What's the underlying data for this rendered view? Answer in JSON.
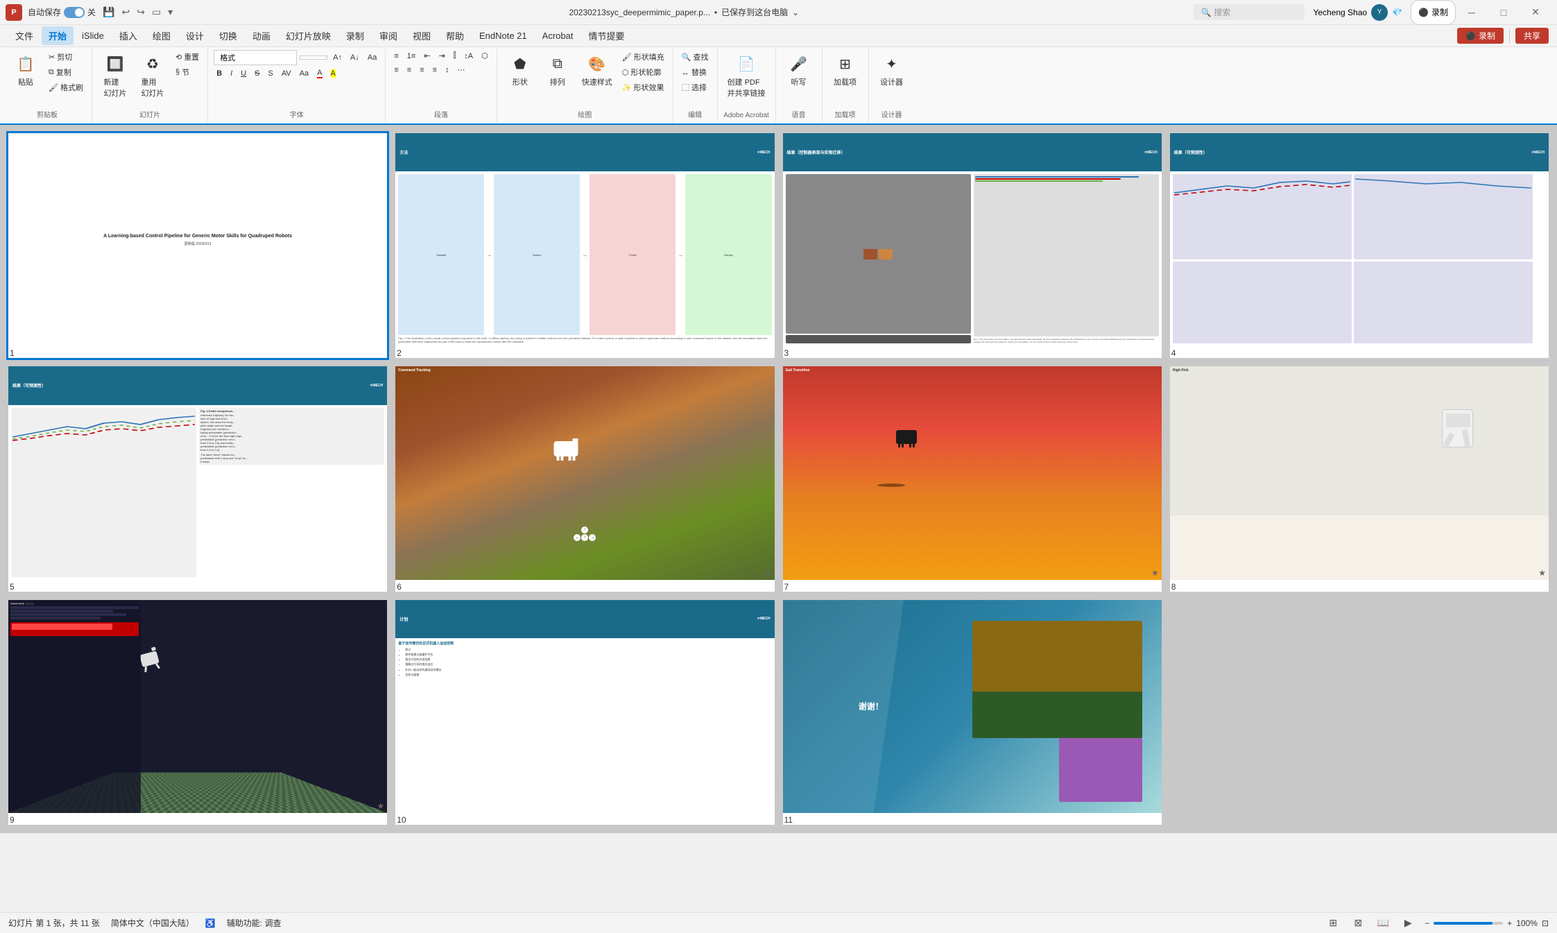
{
  "titlebar": {
    "autosave_label": "自动保存",
    "toggle_state": "on",
    "filename": "20230213syc_deepermimic_paper.p...",
    "save_status": "已保存到这台电脑",
    "search_placeholder": "搜索",
    "user_name": "Yecheng Shao",
    "record_label": "录制",
    "share_label": "共享",
    "cam_label": "录制"
  },
  "menubar": {
    "items": [
      "文件",
      "开始",
      "iSlide",
      "插入",
      "绘图",
      "设计",
      "切换",
      "动画",
      "幻灯片放映",
      "录制",
      "审阅",
      "视图",
      "帮助",
      "EndNote 21",
      "Acrobat",
      "情节提要"
    ]
  },
  "ribbon": {
    "groups": [
      {
        "label": "剪贴板",
        "buttons": [
          "粘贴",
          "剪切",
          "复制",
          "格式刷"
        ]
      },
      {
        "label": "幻灯片",
        "buttons": [
          "新建\n幻灯片",
          "重用\n幻灯片",
          "重置",
          "节"
        ]
      },
      {
        "label": "字体",
        "buttons": [
          "格式",
          "B",
          "I",
          "U",
          "S",
          "字体颜色"
        ]
      },
      {
        "label": "段落",
        "buttons": [
          "项目符号",
          "编号",
          "对齐"
        ]
      },
      {
        "label": "绘图",
        "buttons": [
          "形状",
          "排列",
          "快速样式",
          "形状填充",
          "形状轮廓",
          "形状效果"
        ]
      },
      {
        "label": "编辑",
        "buttons": [
          "查找",
          "替换",
          "选择"
        ]
      },
      {
        "label": "Adobe Acrobat",
        "buttons": [
          "创建 PDF\n并共享链接"
        ]
      },
      {
        "label": "语音",
        "buttons": [
          "听写"
        ]
      },
      {
        "label": "加载项",
        "buttons": [
          "加载项"
        ]
      },
      {
        "label": "设计器",
        "buttons": [
          "设计器"
        ]
      }
    ]
  },
  "slides": [
    {
      "number": "1",
      "type": "title",
      "title": "A Learning-based Control Pipeline for Generic Motor Skills for Quadruped Robots",
      "subtitle": "邵奕程\n20230213",
      "selected": true
    },
    {
      "number": "2",
      "type": "method",
      "header": "方法",
      "logo": "XMECH"
    },
    {
      "number": "3",
      "type": "results_transfer",
      "header": "结果（控制器表现与实物迁移）",
      "logo": "XMECH"
    },
    {
      "number": "4",
      "type": "results_predictability",
      "header": "结果（可预测性）",
      "logo": "XMECH"
    },
    {
      "number": "5",
      "type": "results_predictability2",
      "header": "结果（可预测性）",
      "logo": "XMECH"
    },
    {
      "number": "6",
      "type": "command_tracking",
      "label": "Command Tracking",
      "has_star": true
    },
    {
      "number": "7",
      "type": "gait_transition",
      "label": "Gait Transition",
      "has_star": true
    },
    {
      "number": "8",
      "type": "high_kick",
      "label": "High Kick",
      "has_star": true
    },
    {
      "number": "9",
      "type": "forward_jump",
      "label": "forward Jump",
      "has_star": true
    },
    {
      "number": "10",
      "type": "plan",
      "header": "计划",
      "logo": "XMECH",
      "items": [
        "基于动作模仿的足式机器人运动控制",
        "探讨",
        "提供背景与软硬件平台",
        "相位引导的步态切换",
        "落脚点引导的地形适应",
        "针对一般动作的通用动作模仿",
        "总结与展望"
      ]
    },
    {
      "number": "11",
      "type": "thankyou",
      "text": "谢谢！"
    }
  ],
  "statusbar": {
    "slide_info": "幻灯片 第 1 张，共 11 张",
    "language": "简体中文（中国大陆）",
    "accessibility": "辅助功能: 调查",
    "zoom": "100%",
    "zoom_icon": "🔍"
  }
}
